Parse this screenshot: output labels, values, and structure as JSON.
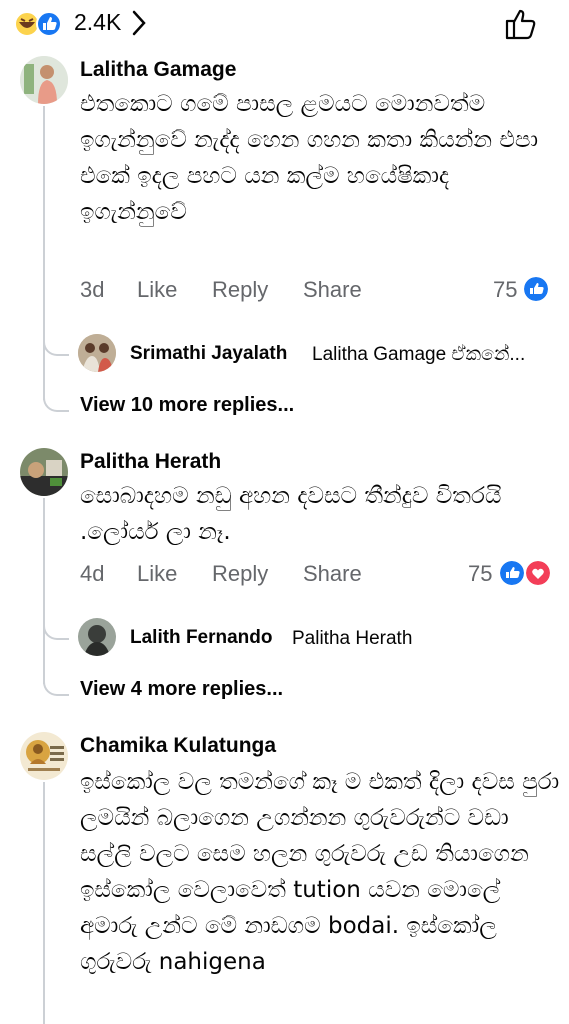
{
  "top": {
    "reaction_count": "2.4K",
    "icons": [
      "haha-reaction-icon",
      "like-reaction-icon",
      "chevron-right-icon",
      "like-thumb-icon"
    ]
  },
  "comments": [
    {
      "author": "Lalitha Gamage",
      "text": "එතකොට ගමේ පාසල ළමයට මොනවත්ම ඉගැන්නුවේ නැද්ද හෙන ගහන කතා කියන්න එපා එකේ ඉදල පහට යන කල්ම හයේෂිකාද ඉගැන්නුවේ",
      "time": "3d",
      "like": "Like",
      "reply": "Reply",
      "share": "Share",
      "reactions": "75",
      "reply_preview": {
        "author": "Srimathi Jayalath",
        "text": "Lalitha Gamage ඒකනේ..."
      },
      "view_more": "View 10 more replies..."
    },
    {
      "author": "Palitha Herath",
      "text": "සොබාදහම නඩු අහන දවසට තීන්දුව විතරයි .ලෝයර් ලා නෑ.",
      "time": "4d",
      "like": "Like",
      "reply": "Reply",
      "share": "Share",
      "reactions": "75",
      "reply_preview": {
        "author": "Lalith Fernando",
        "text": "Palitha Herath"
      },
      "view_more": "View 4 more replies..."
    },
    {
      "author": "Chamika Kulatunga",
      "text": "ඉස්කෝල වල තමන්ගේ කෑ ම එකත් දිලා දවස පුරා ලමයින් බලාගෙන උගන්නන ගුරුවරුන්ට වඩා සල්ලි වලට සෙම හලන ගුරුවරු උඩ තියාගෙන ඉස්කෝල වෙලාවෙත් tution යවන මොලේ අමාරු උන්ට මේ නාඩගම bodai. ඉස්කෝල ගුරුවරු nahigena"
    }
  ],
  "colors": {
    "like_blue": "#1877f2",
    "love_red": "#f33e58",
    "secondary_text": "#65676b",
    "thread_line": "#ccd0d5"
  }
}
